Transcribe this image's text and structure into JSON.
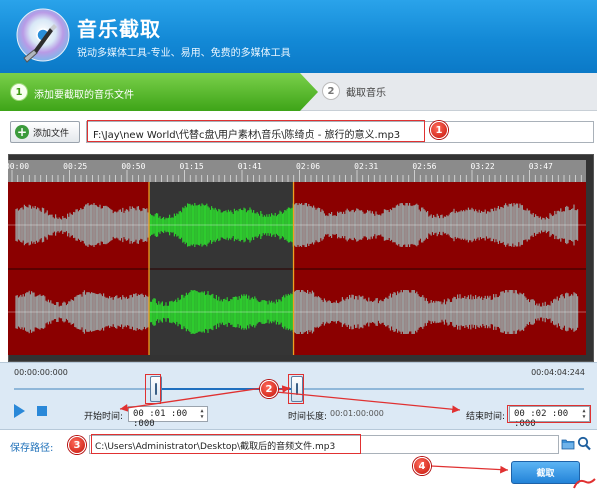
{
  "app": {
    "title": "音乐截取",
    "subtitle": "锐动多媒体工具-专业、易用、免费的多媒体工具"
  },
  "steps": [
    {
      "num": "1",
      "label": "添加要截取的音乐文件"
    },
    {
      "num": "2",
      "label": "截取音乐"
    }
  ],
  "file": {
    "add_label": "添加文件",
    "path": "F:\\Jay\\new World\\代替c盘\\用户素材\\音乐\\陈绮贞 - 旅行的意义.mp3"
  },
  "ruler": {
    "ticks": [
      "00:00",
      "00:25",
      "00:50",
      "01:15",
      "01:41",
      "02:06",
      "02:31",
      "02:56",
      "03:22",
      "03:47"
    ]
  },
  "selection": {
    "start_fraction": 0.244,
    "end_fraction": 0.494
  },
  "timeline": {
    "start_label": "00:00:00:000",
    "end_label": "00:04:04:244"
  },
  "controls": {
    "start_time_label": "开始时间:",
    "start_time_value": "00 :01 :00 :000",
    "duration_label": "时间长度:",
    "duration_value": "00:01:00:000",
    "end_time_label": "结束时间:",
    "end_time_value": "00 :02 :00 :000"
  },
  "save": {
    "label": "保存路径:",
    "path": "C:\\Users\\Administrator\\Desktop\\截取后的音频文件.mp3",
    "cut_label": "截取"
  },
  "annotations": [
    "1",
    "2",
    "3",
    "4"
  ],
  "colors": {
    "header": "#1389d6",
    "step_active": "#4cb528",
    "wave_background": "#8b0000",
    "wave_selected": "#2ecc2e",
    "wave_unselected": "#9a9a9a",
    "annotation": "#e03131"
  }
}
